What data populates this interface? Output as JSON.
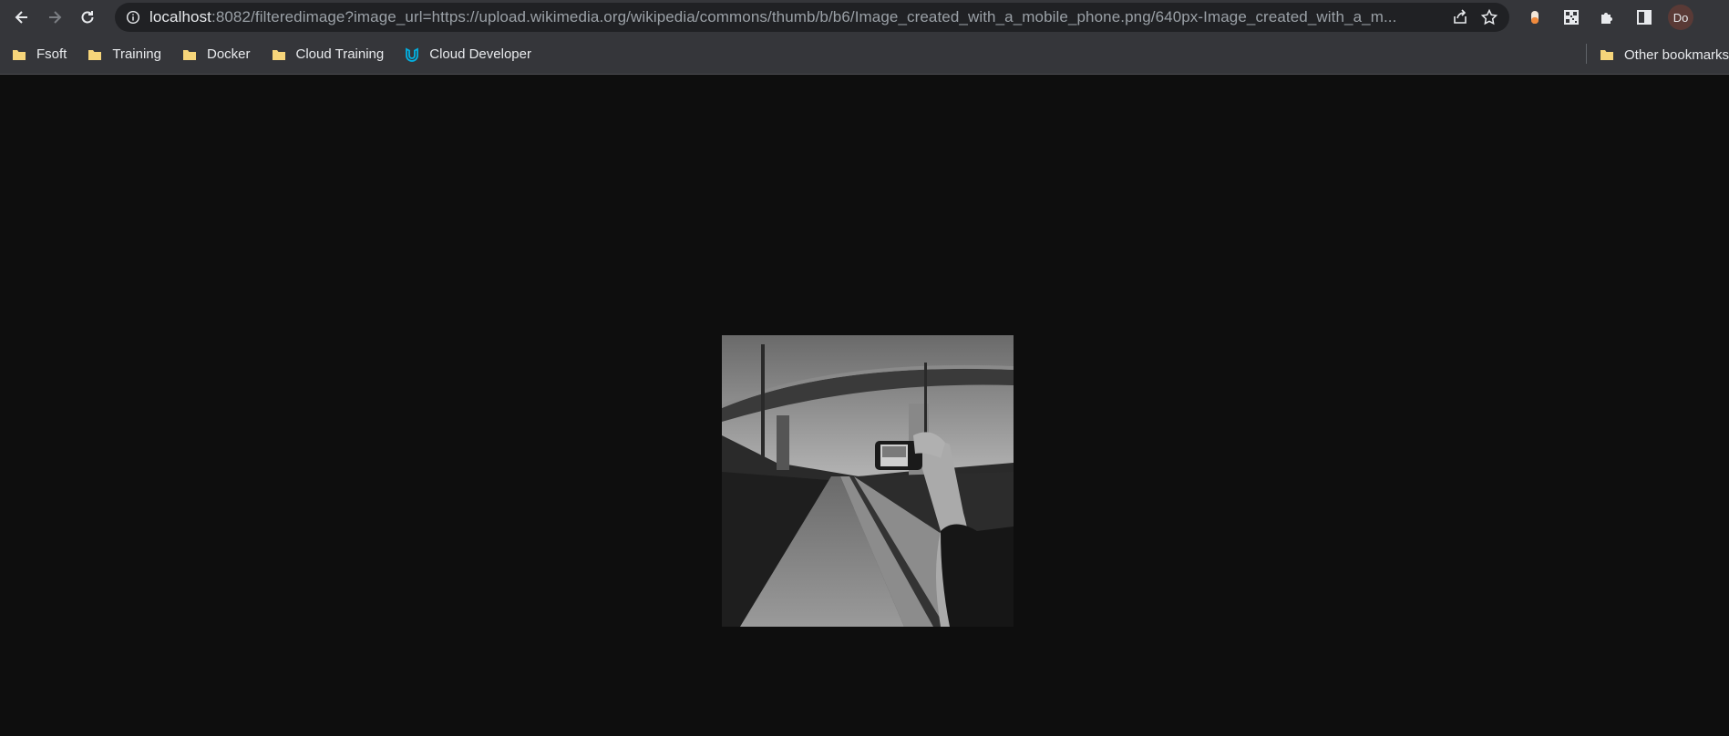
{
  "browser": {
    "url_host": "localhost",
    "url_rest": ":8082/filteredimage?image_url=https://upload.wikimedia.org/wikipedia/commons/thumb/b/b6/Image_created_with_a_mobile_phone.png/640px-Image_created_with_a_m...",
    "profile_initials": "Do"
  },
  "bookmarks": [
    {
      "label": "Fsoft",
      "icon": "folder-icon"
    },
    {
      "label": "Training",
      "icon": "folder-icon"
    },
    {
      "label": "Docker",
      "icon": "folder-icon"
    },
    {
      "label": "Cloud Training",
      "icon": "folder-icon"
    },
    {
      "label": "Cloud Developer",
      "icon": "udacity-icon"
    }
  ],
  "other_bookmarks": "Other bookmarks",
  "colors": {
    "chrome_bg": "#35363a",
    "omnibox_bg": "#202124",
    "page_bg": "#0e0e0e",
    "folder": "#f6d57a",
    "udacity": "#02b3e4"
  }
}
